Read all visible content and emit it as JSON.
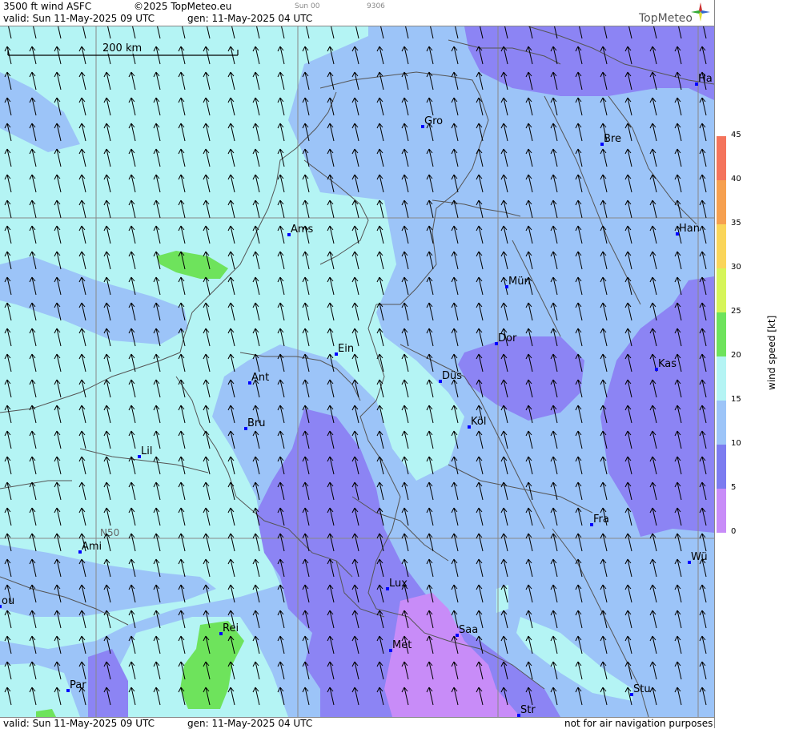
{
  "header": {
    "product": "3500 ft wind ASFC",
    "copyright": "©2025 TopMeteo.eu",
    "valid": "valid:  Sun  11-May-2025  09 UTC",
    "generated": "gen: 11-May-2025 04 UTC",
    "small_day": "Sun 00",
    "small_code": "9306",
    "logo": "TopMeteo"
  },
  "footer": {
    "valid": "valid:  Sun  11-May-2025  09 UTC",
    "generated": "gen: 11-May-2025 04 UTC",
    "disclaimer": "not for air navigation purposes"
  },
  "scalebar": {
    "label": "200 km"
  },
  "grid_label": "N50",
  "colorbar": {
    "title": "wind  speed  [kt]",
    "ticks": [
      "45",
      "40",
      "35",
      "30",
      "25",
      "20",
      "15",
      "10",
      "5",
      "0"
    ],
    "colors": [
      "#f4745c",
      "#f6a050",
      "#fad55a",
      "#d6f55a",
      "#6ee35c",
      "#b4f4f4",
      "#9cc4f8",
      "#7c7cf0",
      "#c88cf8"
    ],
    "units": "kt"
  },
  "cities": [
    {
      "name": "Ha"
    },
    {
      "name": "Gro"
    },
    {
      "name": "Bre"
    },
    {
      "name": "Ams"
    },
    {
      "name": "Han"
    },
    {
      "name": "Mün"
    },
    {
      "name": "Ein"
    },
    {
      "name": "Dor"
    },
    {
      "name": "Kas"
    },
    {
      "name": "Ant"
    },
    {
      "name": "Düs"
    },
    {
      "name": "Bru"
    },
    {
      "name": "Köl"
    },
    {
      "name": "Lil"
    },
    {
      "name": "Fra"
    },
    {
      "name": "Ami"
    },
    {
      "name": "Wü"
    },
    {
      "name": "Lux"
    },
    {
      "name": "ou"
    },
    {
      "name": "Rei"
    },
    {
      "name": "Saa"
    },
    {
      "name": "Met"
    },
    {
      "name": "Par"
    },
    {
      "name": "Stu"
    },
    {
      "name": "Str"
    }
  ]
}
